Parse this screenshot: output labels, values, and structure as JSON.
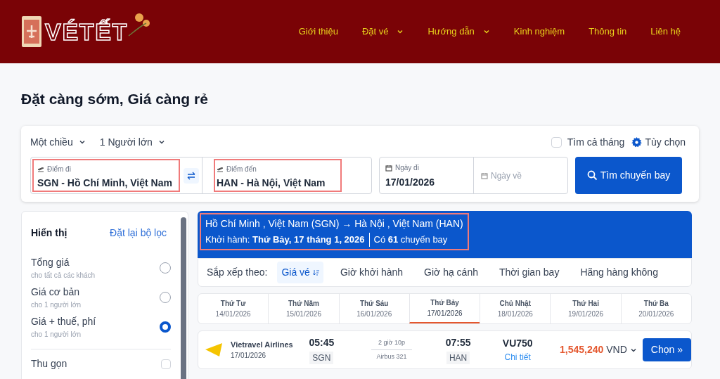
{
  "header": {
    "logo": "VÉTẾT",
    "nav": [
      {
        "label": "Giới thiệu",
        "dropdown": false
      },
      {
        "label": "Đặt vé",
        "dropdown": true
      },
      {
        "label": "Hướng dẫn",
        "dropdown": true
      },
      {
        "label": "Kinh nghiệm",
        "dropdown": false
      },
      {
        "label": "Thông tin",
        "dropdown": false
      },
      {
        "label": "Liên hệ",
        "dropdown": false
      }
    ]
  },
  "page_title": "Đặt càng sớm, Giá càng rẻ",
  "search": {
    "trip_type": "Một chiều",
    "passengers": "1 Người lớn",
    "whole_month": {
      "label": "Tìm cả tháng",
      "checked": false
    },
    "options": "Tùy chọn",
    "from": {
      "label": "Điểm đi",
      "value": "SGN - Hồ Chí Minh, Việt Nam"
    },
    "to": {
      "label": "Điểm đến",
      "value": "HAN - Hà Nội, Việt Nam"
    },
    "depart": {
      "label": "Ngày đi",
      "value": "17/01/2026"
    },
    "return": {
      "placeholder": "Ngày về"
    },
    "button": "Tìm chuyến bay"
  },
  "filters": {
    "title": "Hiển thị",
    "reset": "Đặt lại bộ lọc",
    "price_modes": [
      {
        "label": "Tổng giá",
        "note": "cho tất cả các khách",
        "selected": false
      },
      {
        "label": "Giá cơ bản",
        "note": "cho 1 người lớn",
        "selected": false
      },
      {
        "label": "Giá + thuế, phí",
        "note": "cho 1 người lớn",
        "selected": true
      }
    ],
    "collapse": {
      "label": "Thu gọn",
      "checked": false
    }
  },
  "route": {
    "title": "Hồ Chí Minh , Việt Nam (SGN) → Hà Nội , Việt Nam (HAN)",
    "departure": "Khởi hành: **Thứ Bảy, 17 tháng 1, 2026**",
    "count": "Có **61** chuyến bay"
  },
  "sort": {
    "label": "Sắp xếp theo:",
    "options": [
      {
        "label": "Giá vé",
        "selected": true
      },
      {
        "label": "Giờ khởi hành",
        "selected": false
      },
      {
        "label": "Giờ hạ cánh",
        "selected": false
      },
      {
        "label": "Thời gian bay",
        "selected": false
      },
      {
        "label": "Hãng hàng không",
        "selected": false
      }
    ]
  },
  "dates": [
    {
      "day": "Thứ Tư",
      "date": "14/01/2026",
      "selected": false
    },
    {
      "day": "Thứ Năm",
      "date": "15/01/2026",
      "selected": false
    },
    {
      "day": "Thứ Sáu",
      "date": "16/01/2026",
      "selected": false
    },
    {
      "day": "Thứ Bảy",
      "date": "17/01/2026",
      "selected": true
    },
    {
      "day": "Chủ Nhật",
      "date": "18/01/2026",
      "selected": false
    },
    {
      "day": "Thứ Hai",
      "date": "19/01/2026",
      "selected": false
    },
    {
      "day": "Thứ Ba",
      "date": "20/01/2026",
      "selected": false
    }
  ],
  "flights": [
    {
      "airline": "Vietravel Airlines",
      "date": "17/01/2026",
      "depart_time": "05:45",
      "depart_code": "SGN",
      "duration": "2 giờ 10p",
      "aircraft": "Airbus 321",
      "arrive_time": "07:55",
      "arrive_code": "HAN",
      "flight_no": "VU750",
      "details": "Chi tiết",
      "price": "1,545,240",
      "currency": "VND",
      "button": "Chọn »"
    }
  ]
}
